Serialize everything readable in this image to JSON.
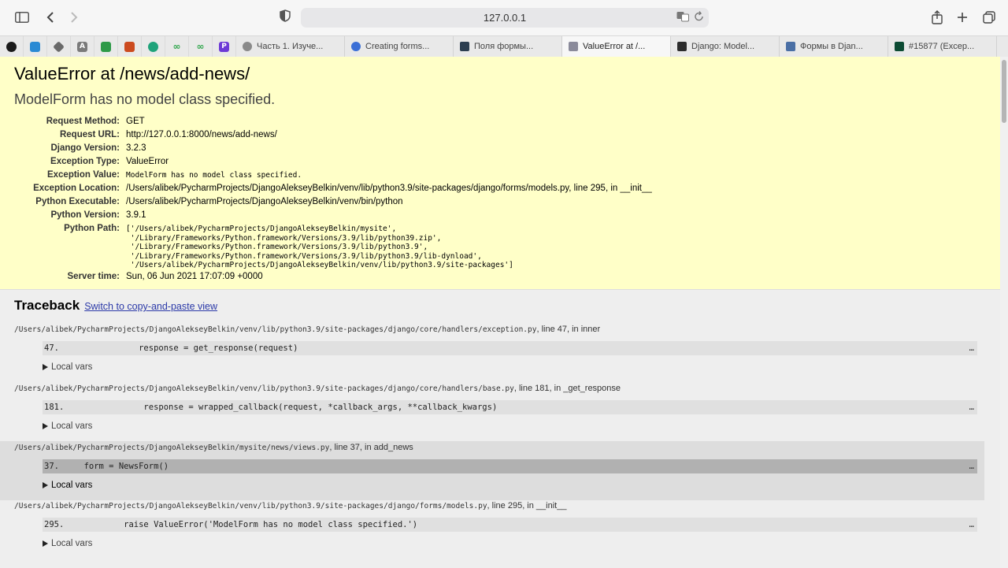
{
  "browser": {
    "url": "127.0.0.1",
    "tabs": [
      {
        "title": "Часть 1. Изуче...",
        "favicon": "compass-icon",
        "color": "#8a8a8a"
      },
      {
        "title": "Creating forms...",
        "favicon": "blue-circle-icon",
        "color": "#3b6fd6"
      },
      {
        "title": "Поля формы...",
        "favicon": "pycharm-icon",
        "color": "#2c3e50"
      },
      {
        "title": "ValueError at /...",
        "favicon": "number-1-icon",
        "color": "#8a8a9a",
        "active": true
      },
      {
        "title": "Django: Model...",
        "favicon": "django-icon",
        "color": "#2c2c2c"
      },
      {
        "title": "Формы в Djan...",
        "favicon": "book-icon",
        "color": "#4a6fa5"
      },
      {
        "title": "#15877 (Excep...",
        "favicon": "dj-icon",
        "color": "#0c4b33"
      }
    ],
    "pinned": [
      {
        "name": "pinned-dark-circle-icon",
        "color": "#1a1a1a",
        "glyph": ""
      },
      {
        "name": "pinned-blue-square-icon",
        "color": "#2a8ad4",
        "glyph": ""
      },
      {
        "name": "pinned-diamond-icon",
        "color": "#6a6a6a",
        "glyph": ""
      },
      {
        "name": "pinned-a-icon",
        "color": "#7a7a7a",
        "glyph": "A"
      },
      {
        "name": "pinned-drive-icon",
        "color": "#2e9a48",
        "glyph": ""
      },
      {
        "name": "pinned-brave-icon",
        "color": "#cc4b1f",
        "glyph": ""
      },
      {
        "name": "pinned-green-circle-icon",
        "color": "#1fa37a",
        "glyph": ""
      },
      {
        "name": "pinned-infinity-green-icon",
        "color": "#2fa64b",
        "glyph": "∞"
      },
      {
        "name": "pinned-infinity-green2-icon",
        "color": "#2fa64b",
        "glyph": "∞"
      },
      {
        "name": "pinned-p-icon",
        "color": "#6d3ad6",
        "glyph": "P"
      }
    ]
  },
  "summary": {
    "title": "ValueError at /news/add-news/",
    "message": "ModelForm has no model class specified.",
    "rows": {
      "request_method": {
        "k": "Request Method:",
        "v": "GET"
      },
      "request_url": {
        "k": "Request URL:",
        "v": "http://127.0.0.1:8000/news/add-news/"
      },
      "django_version": {
        "k": "Django Version:",
        "v": "3.2.3"
      },
      "exception_type": {
        "k": "Exception Type:",
        "v": "ValueError"
      },
      "exception_value": {
        "k": "Exception Value:",
        "v": "ModelForm has no model class specified."
      },
      "exception_location": {
        "k": "Exception Location:",
        "v_path": "/Users/alibek/PycharmProjects/DjangoAlekseyBelkin/venv/lib/python3.9/site-packages/django/forms/models.py",
        "v_line": ", line 295",
        "v_in": ", in __init__"
      },
      "python_executable": {
        "k": "Python Executable:",
        "v": "/Users/alibek/PycharmProjects/DjangoAlekseyBelkin/venv/bin/python"
      },
      "python_version": {
        "k": "Python Version:",
        "v": "3.9.1"
      },
      "python_path": {
        "k": "Python Path:",
        "v": "['/Users/alibek/PycharmProjects/DjangoAlekseyBelkin/mysite',\n '/Library/Frameworks/Python.framework/Versions/3.9/lib/python39.zip',\n '/Library/Frameworks/Python.framework/Versions/3.9/lib/python3.9',\n '/Library/Frameworks/Python.framework/Versions/3.9/lib/python3.9/lib-dynload',\n '/Users/alibek/PycharmProjects/DjangoAlekseyBelkin/venv/lib/python3.9/site-packages']"
      },
      "server_time": {
        "k": "Server time:",
        "v": "Sun, 06 Jun 2021 17:07:09 +0000"
      }
    }
  },
  "traceback": {
    "title": "Traceback",
    "switch_link": "Switch to copy-and-paste view",
    "local_vars_label": "Local vars",
    "ellipsis": "…",
    "frames": [
      {
        "path": "/Users/alibek/PycharmProjects/DjangoAlekseyBelkin/venv/lib/python3.9/site-packages/django/core/handlers/exception.py",
        "loc": ", line 47, in inner",
        "code": "47.                response = get_response(request)"
      },
      {
        "path": "/Users/alibek/PycharmProjects/DjangoAlekseyBelkin/venv/lib/python3.9/site-packages/django/core/handlers/base.py",
        "loc": ", line 181, in _get_response",
        "code": "181.                response = wrapped_callback(request, *callback_args, **callback_kwargs)"
      },
      {
        "path": "/Users/alibek/PycharmProjects/DjangoAlekseyBelkin/mysite/news/views.py",
        "loc": ", line 37, in add_news",
        "code": "37.     form = NewsForm()"
      },
      {
        "path": "/Users/alibek/PycharmProjects/DjangoAlekseyBelkin/venv/lib/python3.9/site-packages/django/forms/models.py",
        "loc": ", line 295, in __init__",
        "code": "295.            raise ValueError('ModelForm has no model class specified.')"
      }
    ]
  }
}
